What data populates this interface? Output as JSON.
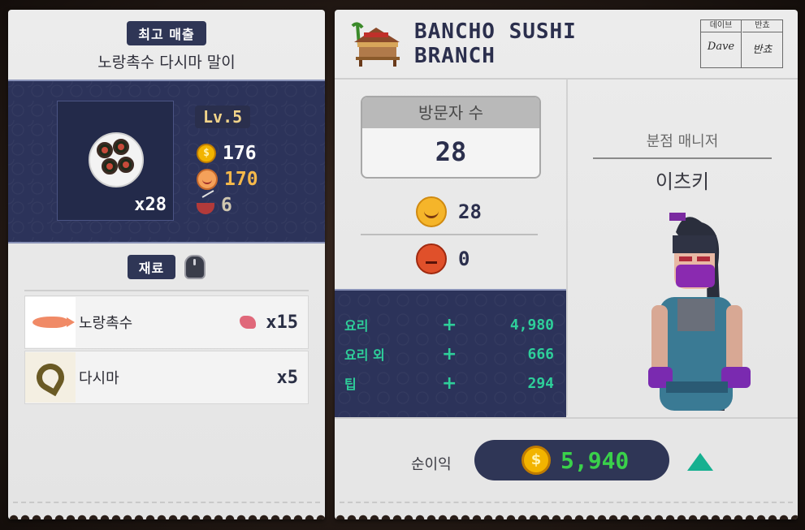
{
  "best_seller": {
    "title": "최고 매출",
    "name": "노랑촉수 다시마 말이",
    "count": "x28",
    "level": "Lv.5",
    "price": "176",
    "taste": "170",
    "servings": "6"
  },
  "materials": {
    "title": "재료",
    "items": [
      {
        "name": "노랑촉수",
        "qty": "x15"
      },
      {
        "name": "다시마",
        "qty": "x5"
      }
    ]
  },
  "branch": {
    "name_line1": "BANCHO SUSHI",
    "name_line2": "BRANCH",
    "sign_labels": [
      "데이브",
      "반쵸"
    ],
    "sign_dave": "Dave",
    "sign_bancho": "반쵸"
  },
  "visitors": {
    "label": "방문자 수",
    "count": "28",
    "happy": "28",
    "angry": "0"
  },
  "revenue": {
    "rows": [
      {
        "label": "요리",
        "value": "4,980"
      },
      {
        "label": "요리 외",
        "value": "666"
      },
      {
        "label": "팁",
        "value": "294"
      }
    ],
    "plus_symbol": "+"
  },
  "manager": {
    "label": "분점 매니저",
    "name": "이츠키"
  },
  "net_profit": {
    "label": "순이익",
    "value": "5,940",
    "trend": "up",
    "trend_color": "#16b090"
  },
  "icons": {
    "coin_glyph": "$"
  }
}
